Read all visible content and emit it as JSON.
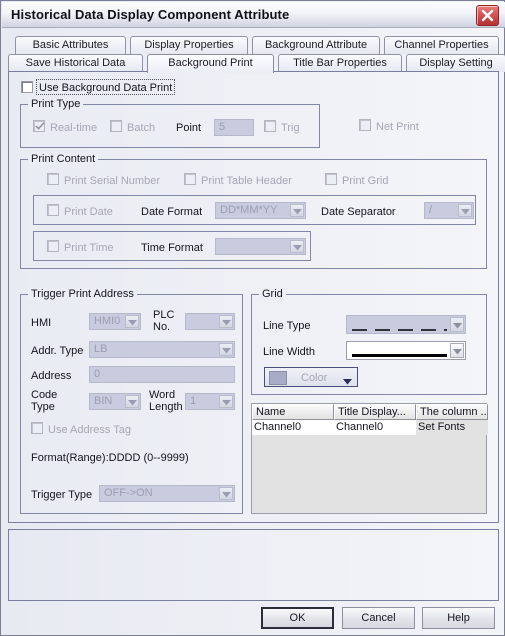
{
  "window": {
    "title": "Historical Data Display Component Attribute",
    "close_icon": "close-icon"
  },
  "tabs": {
    "row1": [
      {
        "label": "Basic Attributes",
        "active": false
      },
      {
        "label": "Display Properties",
        "active": false
      },
      {
        "label": "Background Attribute",
        "active": false
      },
      {
        "label": "Channel Properties",
        "active": false
      }
    ],
    "row2": [
      {
        "label": "Save Historical Data",
        "active": false
      },
      {
        "label": "Background Print",
        "active": true
      },
      {
        "label": "Title Bar Properties",
        "active": false
      },
      {
        "label": "Display Setting",
        "active": false
      }
    ]
  },
  "use_background_data_print": {
    "label": "Use Background Data Print",
    "checked": false
  },
  "print_type": {
    "legend": "Print Type",
    "realtime": {
      "label": "Real-time",
      "checked": true,
      "disabled": true
    },
    "batch": {
      "label": "Batch",
      "checked": false,
      "disabled": true
    },
    "point": {
      "label": "Point",
      "value": "5",
      "disabled": true
    },
    "trig": {
      "label": "Trig",
      "checked": false,
      "disabled": true
    },
    "net_print": {
      "label": "Net Print",
      "checked": false,
      "disabled": true
    }
  },
  "print_content": {
    "legend": "Print Content",
    "print_serial_number": {
      "label": "Print Serial Number",
      "checked": false,
      "disabled": true
    },
    "print_table_header": {
      "label": "Print Table Header",
      "checked": false,
      "disabled": true
    },
    "print_grid": {
      "label": "Print Grid",
      "checked": false,
      "disabled": true
    },
    "print_date": {
      "label": "Print Date",
      "checked": false,
      "disabled": true
    },
    "date_format": {
      "label": "Date Format",
      "value": "DD*MM*YY",
      "disabled": true
    },
    "date_separator": {
      "label": "Date Separator",
      "value": "/",
      "disabled": true
    },
    "print_time": {
      "label": "Print Time",
      "checked": false,
      "disabled": true
    },
    "time_format": {
      "label": "Time Format",
      "value": "",
      "disabled": true
    }
  },
  "trigger_print_address": {
    "legend": "Trigger Print Address",
    "hmi": {
      "label": "HMI",
      "value": "HMI0",
      "disabled": true
    },
    "plc_no": {
      "label": "PLC No.",
      "value": "",
      "disabled": true
    },
    "addr_type": {
      "label": "Addr. Type",
      "value": "LB",
      "disabled": true
    },
    "address": {
      "label": "Address",
      "value": "0",
      "disabled": true
    },
    "code_type": {
      "label": "Code Type",
      "value": "BIN",
      "disabled": true
    },
    "word_length": {
      "label": "Word Length",
      "value": "1",
      "disabled": true
    },
    "use_address_tag": {
      "label": "Use Address Tag",
      "checked": false,
      "disabled": true
    },
    "format_range": "Format(Range):DDDD (0--9999)",
    "trigger_type": {
      "label": "Trigger Type",
      "value": "OFF->ON",
      "disabled": true
    }
  },
  "grid": {
    "legend": "Grid",
    "line_type": {
      "label": "Line Type",
      "style": "dashed",
      "disabled": true
    },
    "line_width": {
      "label": "Line Width",
      "style": "solid",
      "disabled": false
    },
    "color": {
      "label": "Color",
      "swatch": "#a9acc6",
      "disabled": true
    }
  },
  "channel_table": {
    "columns": [
      "Name",
      "Title Display...",
      "The column ..."
    ],
    "rows": [
      [
        "Channel0",
        "Channel0",
        "Set Fonts"
      ]
    ]
  },
  "footer": {
    "ok": "OK",
    "cancel": "Cancel",
    "help": "Help"
  }
}
